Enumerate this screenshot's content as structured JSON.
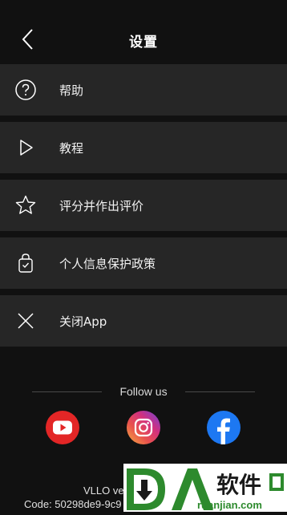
{
  "header": {
    "title": "设置"
  },
  "menu": {
    "items": [
      {
        "label": "帮助",
        "icon": "help-circle-icon"
      },
      {
        "label": "教程",
        "icon": "play-icon"
      },
      {
        "label": "评分并作出评价",
        "icon": "star-icon"
      },
      {
        "label": "个人信息保护政策",
        "icon": "privacy-lock-icon"
      },
      {
        "label": "关闭App",
        "icon": "close-icon"
      }
    ]
  },
  "follow": {
    "label": "Follow us"
  },
  "social": {
    "youtube": {
      "icon": "youtube-icon",
      "color": "#e32626"
    },
    "instagram": {
      "icon": "instagram-icon"
    },
    "facebook": {
      "icon": "facebook-icon",
      "color": "#1d78f2"
    }
  },
  "footer": {
    "version": "VLLO ve",
    "code": "Code: 50298de9-9c9"
  },
  "watermark": {
    "text": "软件",
    "sub": "ruanjian.com"
  },
  "colors": {
    "background": "#111111",
    "item_background": "#262626"
  }
}
